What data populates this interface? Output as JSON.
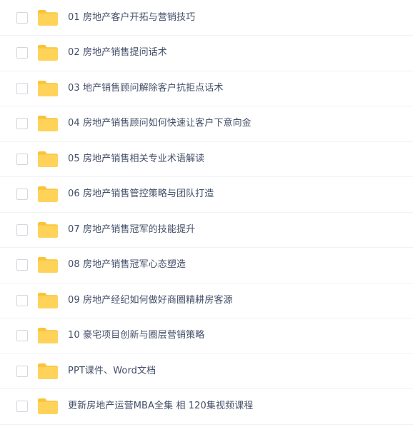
{
  "files": [
    {
      "name": "01 房地产客户开拓与营销技巧",
      "type": "folder",
      "selected": false
    },
    {
      "name": "02 房地产销售提问话术",
      "type": "folder",
      "selected": false
    },
    {
      "name": "03 地产销售顾问解除客户抗拒点话术",
      "type": "folder",
      "selected": false
    },
    {
      "name": "04 房地产销售顾问如何快速让客户下意向金",
      "type": "folder",
      "selected": false
    },
    {
      "name": "05 房地产销售相关专业术语解读",
      "type": "folder",
      "selected": false
    },
    {
      "name": "06 房地产销售管控策略与团队打造",
      "type": "folder",
      "selected": false
    },
    {
      "name": "07 房地产销售冠军的技能提升",
      "type": "folder",
      "selected": false
    },
    {
      "name": "08 房地产销售冠军心态塑造",
      "type": "folder",
      "selected": false
    },
    {
      "name": "09 房地产经纪如何做好商圈精耕房客源",
      "type": "folder",
      "selected": false
    },
    {
      "name": "10 豪宅项目创新与圈层营销策略",
      "type": "folder",
      "selected": false
    },
    {
      "name": "PPT课件、Word文档",
      "type": "folder",
      "selected": false
    },
    {
      "name": "更新房地产运营MBA全集 相 120集视频课程",
      "type": "folder",
      "selected": false
    }
  ],
  "colors": {
    "folder_body": "#ffd359",
    "folder_back": "#f9c43a",
    "text": "#424e67",
    "divider": "#f1f2f4",
    "checkbox_border": "#d3d6dc"
  },
  "icons": {
    "folder": "folder-icon"
  }
}
